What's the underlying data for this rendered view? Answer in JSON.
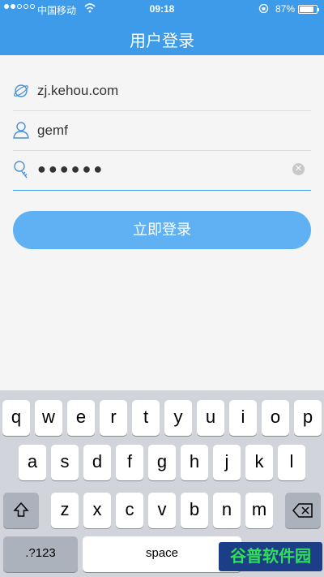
{
  "status_bar": {
    "carrier": "中国移动",
    "time": "09:18",
    "battery_text": "87%",
    "battery_level": 0.87,
    "icons": [
      "signal-dots-icon",
      "wifi-icon",
      "rotation-lock-icon",
      "battery-icon"
    ]
  },
  "header": {
    "title": "用户登录"
  },
  "form": {
    "server": {
      "icon": "server-globe-icon",
      "value": "zj.kehou.com"
    },
    "username": {
      "icon": "user-icon",
      "value": "gemf"
    },
    "password": {
      "icon": "key-icon",
      "value": "●●●●●●",
      "clear_icon": "clear-icon"
    }
  },
  "login_button": {
    "label": "立即登录"
  },
  "keyboard": {
    "row1": [
      "q",
      "w",
      "e",
      "r",
      "t",
      "y",
      "u",
      "i",
      "o",
      "p"
    ],
    "row2": [
      "a",
      "s",
      "d",
      "f",
      "g",
      "h",
      "j",
      "k",
      "l"
    ],
    "row3": [
      "z",
      "x",
      "c",
      "v",
      "b",
      "n",
      "m"
    ],
    "shift_icon": "shift-icon",
    "delete_icon": "backspace-icon",
    "numbers_label": ".?123",
    "space_label": "space"
  },
  "watermark": {
    "text": "谷普软件园"
  },
  "colors": {
    "accent": "#3d9bea",
    "button": "#60b1f4",
    "keyboard_bg": "#d1d5db"
  }
}
